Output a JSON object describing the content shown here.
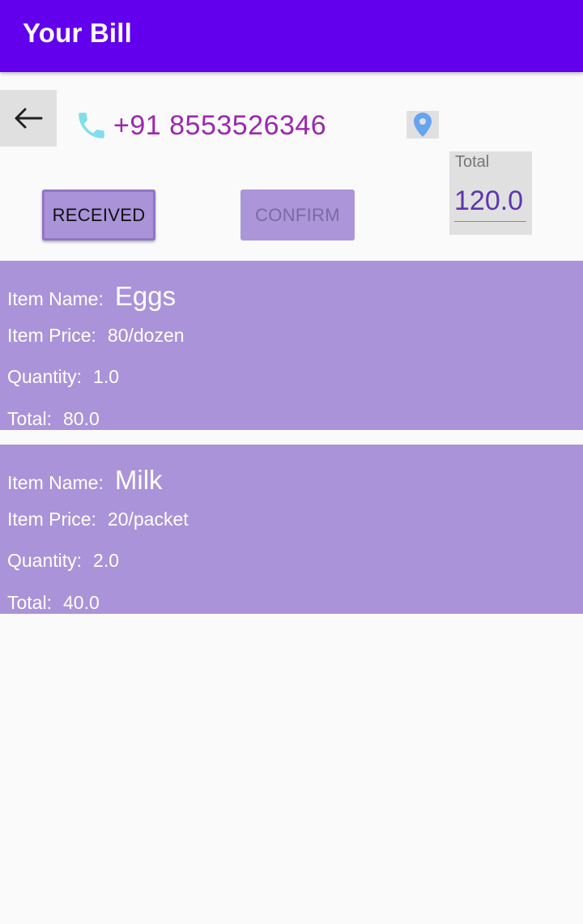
{
  "app_bar": {
    "title": "Your Bill"
  },
  "header": {
    "phone": "+91 8553526346",
    "received_label": "RECEIVED",
    "confirm_label": "CONFIRM",
    "total_label": "Total",
    "total_value": "120.0"
  },
  "colors": {
    "app_bar": "#6200ee",
    "card": "#aa93d8",
    "phone_text": "#9c27b0",
    "phone_icon": "#80deea",
    "location_icon": "#64a4f0"
  },
  "icons": {
    "back": "arrow-left-icon",
    "phone": "phone-icon",
    "location": "location-pin-icon"
  },
  "labels": {
    "item_name": "Item Name:",
    "item_price": "Item Price:",
    "quantity": "Quantity:",
    "total": "Total:"
  },
  "items": [
    {
      "name": "Eggs",
      "price": "80/dozen",
      "quantity": "1.0",
      "total": "80.0"
    },
    {
      "name": "Milk",
      "price": "20/packet",
      "quantity": "2.0",
      "total": "40.0"
    }
  ]
}
